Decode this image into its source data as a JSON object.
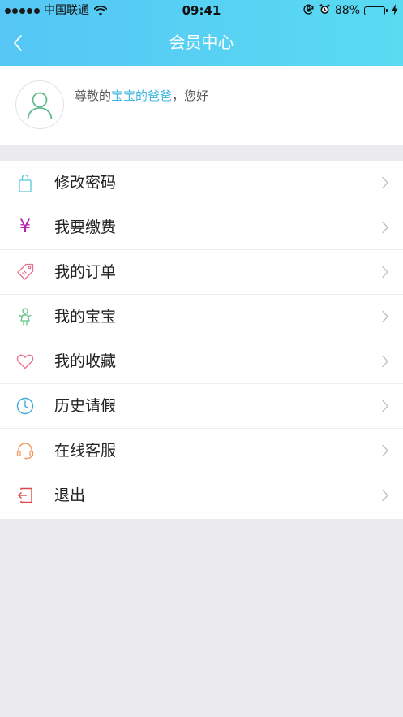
{
  "status_bar": {
    "carrier": "中国联通",
    "time": "09:41",
    "battery_percent_label": "88%",
    "battery_level": 0.88,
    "icons": [
      "signal-dots-icon",
      "wifi-icon",
      "rotation-lock-icon",
      "alarm-icon",
      "battery-icon",
      "charging-icon"
    ]
  },
  "nav": {
    "title": "会员中心",
    "back_icon": "chevron-left-icon"
  },
  "profile": {
    "avatar_icon": "user-outline-icon",
    "greeting_prefix": "尊敬的",
    "name": "宝宝的爸爸",
    "greeting_suffix": "，您好"
  },
  "menu": {
    "items": [
      {
        "label": "修改密码",
        "icon": "lock-icon",
        "color": "#5bc6dd"
      },
      {
        "label": "我要缴费",
        "icon": "yen-icon",
        "glyph": "¥",
        "color": "#b51fb0"
      },
      {
        "label": "我的订单",
        "icon": "tag-icon",
        "color": "#e8708a"
      },
      {
        "label": "我的宝宝",
        "icon": "baby-icon",
        "color": "#5fc586"
      },
      {
        "label": "我的收藏",
        "icon": "heart-icon",
        "color": "#e8708a"
      },
      {
        "label": "历史请假",
        "icon": "clock-icon",
        "color": "#3fa9d8"
      },
      {
        "label": "在线客服",
        "icon": "headset-icon",
        "color": "#f29a5e"
      },
      {
        "label": "退出",
        "icon": "logout-icon",
        "color": "#e04848"
      }
    ],
    "chevron_icon": "chevron-right-icon"
  },
  "colors": {
    "header_gradient_start": "#55c6f5",
    "header_gradient_end": "#59dbf2",
    "accent": "#3fb6e0",
    "background": "#ebebed"
  }
}
